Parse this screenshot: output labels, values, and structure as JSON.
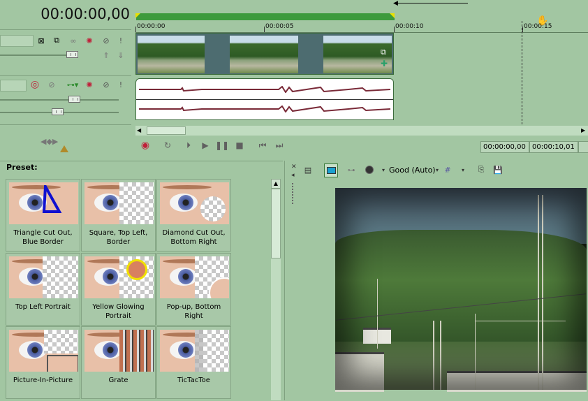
{
  "timeline": {
    "main_timecode": "00:00:00,00",
    "ruler_labels": [
      "00:00:00",
      "00:00:05",
      "00:00:10",
      "00:00:15"
    ],
    "clip_length_seconds": 10
  },
  "transport": {
    "buttons": [
      "record",
      "loop",
      "play-from-start",
      "play",
      "pause",
      "stop",
      "previous-frame",
      "next-frame"
    ],
    "current_time": "00:00:00,00",
    "duration": "00:00:10,01"
  },
  "preset": {
    "heading": "Preset:",
    "tiles": [
      {
        "label": "Triangle Cut Out, Blue Border"
      },
      {
        "label": "Square, Top Left, Border"
      },
      {
        "label": "Diamond Cut Out, Bottom Right"
      },
      {
        "label": "Top Left Portrait"
      },
      {
        "label": "Yellow Glowing Portrait"
      },
      {
        "label": "Pop-up, Bottom Right"
      },
      {
        "label": "Picture-In-Picture"
      },
      {
        "label": "Grate"
      },
      {
        "label": "TicTacToe"
      }
    ]
  },
  "preview": {
    "quality": "Good (Auto)"
  },
  "colors": {
    "panel": "#a2c6a2",
    "ruler_bar": "#3d9a3d",
    "audio_wave": "#7a2a38",
    "record": "#c0203a"
  }
}
